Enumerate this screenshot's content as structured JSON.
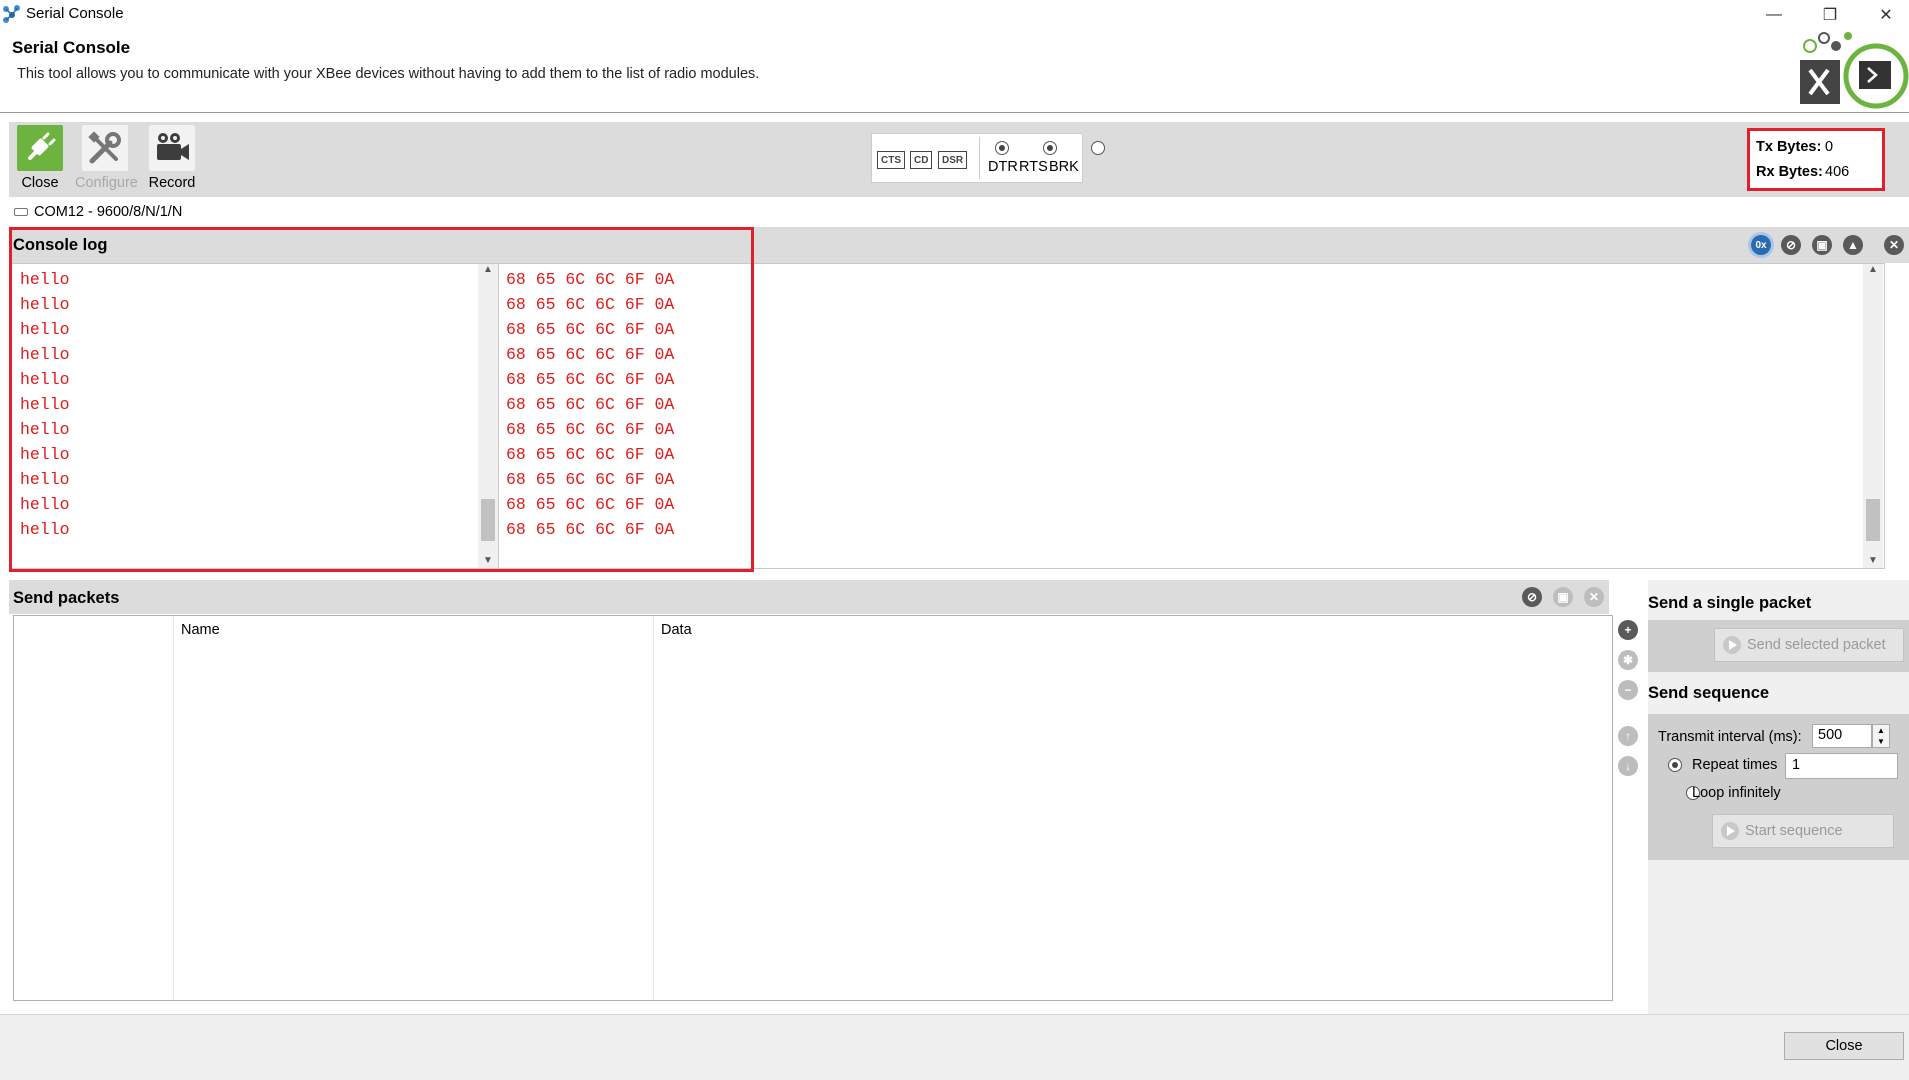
{
  "window": {
    "title": "Serial Console",
    "controls": {
      "minimize": "—",
      "restore": "❐",
      "close": "✕"
    }
  },
  "header": {
    "title": "Serial Console",
    "description": "This tool allows you to communicate with your XBee devices without having to add them to the list of radio modules."
  },
  "toolbar": {
    "close_label": "Close",
    "configure_label": "Configure",
    "record_label": "Record",
    "signals": {
      "cts": "CTS",
      "cd": "CD",
      "dsr": "DSR",
      "dtr": "DTR",
      "rts": "RTS",
      "brk": "BRK",
      "dtr_on": true,
      "rts_on": true,
      "brk_on": false
    },
    "bytes": {
      "tx_label": "Tx Bytes:",
      "tx_value": "0",
      "rx_label": "Rx Bytes:",
      "rx_value": "406"
    }
  },
  "port": {
    "label": "COM12 - 9600/8/N/1/N"
  },
  "console": {
    "title": "Console log",
    "ascii_lines": [
      "hello",
      "hello",
      "hello",
      "hello",
      "hello",
      "hello",
      "hello",
      "hello",
      "hello",
      "hello",
      "hello"
    ],
    "hex_lines": [
      "68 65 6C 6C 6F 0A",
      "68 65 6C 6C 6F 0A",
      "68 65 6C 6C 6F 0A",
      "68 65 6C 6C 6F 0A",
      "68 65 6C 6C 6F 0A",
      "68 65 6C 6C 6F 0A",
      "68 65 6C 6C 6F 0A",
      "68 65 6C 6C 6F 0A",
      "68 65 6C 6C 6F 0A",
      "68 65 6C 6C 6F 0A",
      "68 65 6C 6C 6F 0A"
    ],
    "tool_icons": [
      "hex-toggle-icon",
      "clear-icon",
      "save-icon",
      "lock-icon",
      "close-icon"
    ]
  },
  "send_packets": {
    "title": "Send packets",
    "columns": [
      "",
      "Name",
      "Data"
    ]
  },
  "single_packet": {
    "title": "Send a single packet",
    "send_label": "Send selected packet"
  },
  "sequence": {
    "title": "Send sequence",
    "interval_label": "Transmit interval (ms):",
    "interval_value": "500",
    "repeat_label": "Repeat times",
    "repeat_value": "1",
    "loop_label": "Loop infinitely",
    "start_label": "Start sequence"
  },
  "footer": {
    "close_label": "Close"
  },
  "colors": {
    "accent": "#6cb33f",
    "highlight": "#e0202a",
    "console_text": "#e01b1b"
  }
}
